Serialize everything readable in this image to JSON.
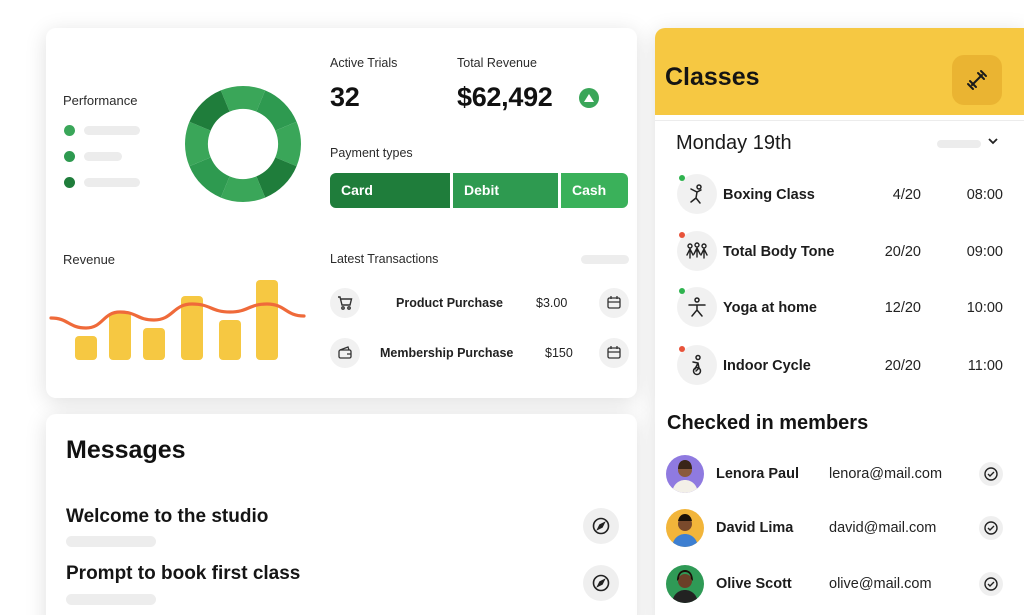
{
  "dashboard": {
    "performance_label": "Performance",
    "performance_legend": [
      {
        "color": "#3aa659"
      },
      {
        "color": "#2e9a50"
      },
      {
        "color": "#1f7d3b"
      }
    ],
    "active_trials_label": "Active Trials",
    "active_trials_value": "32",
    "total_revenue_label": "Total Revenue",
    "total_revenue_value": "$62,492",
    "payment_types_label": "Payment types",
    "payment_types": [
      "Card",
      "Debit",
      "Cash"
    ],
    "revenue_label": "Revenue",
    "latest_transactions_label": "Latest Transactions",
    "transactions": [
      {
        "name": "Product Purchase",
        "amount": "$3.00",
        "icon": "shopping-cart-icon"
      },
      {
        "name": "Membership Purchase",
        "amount": "$150",
        "icon": "wallet-icon"
      }
    ]
  },
  "messages": {
    "title": "Messages",
    "items": [
      {
        "title": "Welcome to the studio",
        "icon": "compass-icon"
      },
      {
        "title": "Prompt to book first class",
        "icon": "compass-icon"
      }
    ]
  },
  "classes": {
    "title": "Classes",
    "header_icon": "dumbbell-icon",
    "date": "Monday 19th",
    "list": [
      {
        "name": "Boxing Class",
        "capacity": "4/20",
        "time": "08:00",
        "icon": "boxing-icon",
        "status_color": "#2fb34f"
      },
      {
        "name": "Total Body Tone",
        "capacity": "20/20",
        "time": "09:00",
        "icon": "group-fitness-icon",
        "status_color": "#e8533a"
      },
      {
        "name": "Yoga at home",
        "capacity": "12/20",
        "time": "10:00",
        "icon": "yoga-icon",
        "status_color": "#2fb34f"
      },
      {
        "name": "Indoor Cycle",
        "capacity": "20/20",
        "time": "11:00",
        "icon": "cycling-icon",
        "status_color": "#e8533a"
      }
    ],
    "checked_in_title": "Checked in members",
    "members": [
      {
        "name": "Lenora Paul",
        "email": "lenora@mail.com"
      },
      {
        "name": "David Lima",
        "email": "david@mail.com"
      },
      {
        "name": "Olive Scott",
        "email": "olive@mail.com"
      }
    ]
  },
  "chart_data": [
    {
      "type": "pie",
      "title": "Performance",
      "values": [
        1,
        1,
        1,
        1,
        1,
        1,
        1,
        1
      ],
      "colors": [
        "#3aa659",
        "#2e9a50",
        "#3aa659",
        "#1f7d3b",
        "#3aa659",
        "#2e9a50",
        "#3aa659",
        "#1f7d3b"
      ]
    },
    {
      "type": "bar",
      "title": "Revenue",
      "values": [
        3,
        6,
        4,
        8,
        5,
        10
      ],
      "line_values": [
        3,
        5,
        4,
        6,
        5,
        6
      ],
      "bar_color": "#f6c842",
      "line_color": "#ef6a3a"
    }
  ]
}
